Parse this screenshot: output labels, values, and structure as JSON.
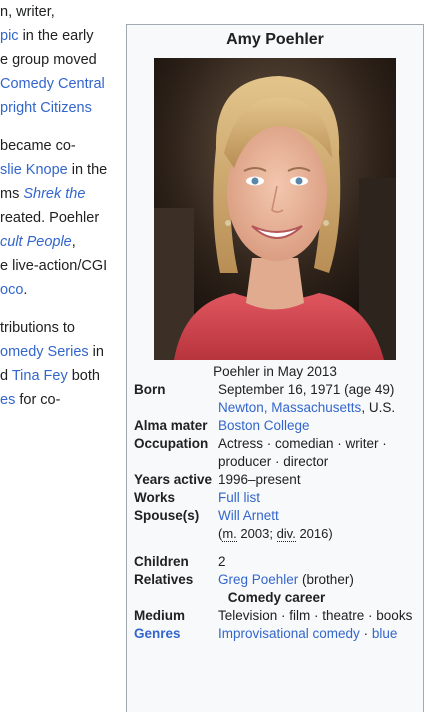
{
  "article": {
    "para1": [
      [
        {
          "t": "n, writer,",
          "c": "plain"
        }
      ],
      [
        {
          "t": "pic",
          "c": "link"
        },
        {
          "t": " in the early",
          "c": "plain"
        }
      ],
      [
        {
          "t": "e group moved",
          "c": "plain"
        }
      ],
      [
        {
          "t": "Comedy Central",
          "c": "link"
        }
      ],
      [
        {
          "t": "pright Citizens",
          "c": "link"
        }
      ]
    ],
    "para2": [
      [
        {
          "t": "became co-",
          "c": "plain"
        }
      ],
      [
        {
          "t": "slie Knope",
          "c": "link"
        },
        {
          "t": " in the",
          "c": "plain"
        }
      ],
      [
        {
          "t": "ms ",
          "c": "plain"
        },
        {
          "t": "Shrek the",
          "c": "link ital"
        }
      ],
      [
        {
          "t": "reated. Poehler",
          "c": "plain"
        }
      ],
      [
        {
          "t": "cult People",
          "c": "link ital"
        },
        {
          "t": ",",
          "c": "plain"
        }
      ],
      [
        {
          "t": "e live-action/CGI",
          "c": "plain"
        }
      ],
      [
        {
          "t": "oco",
          "c": "link"
        },
        {
          "t": ".",
          "c": "plain"
        }
      ]
    ],
    "para3": [
      [
        {
          "t": "tributions to",
          "c": "plain"
        }
      ],
      [
        {
          "t": "omedy Series",
          "c": "link"
        },
        {
          "t": " in",
          "c": "plain"
        }
      ],
      [
        {
          "t": "d ",
          "c": "plain"
        },
        {
          "t": "Tina Fey",
          "c": "link"
        },
        {
          "t": " both",
          "c": "plain"
        }
      ],
      [
        {
          "t": "es",
          "c": "link"
        },
        {
          "t": " for co-",
          "c": "plain"
        }
      ]
    ]
  },
  "infobox": {
    "title": "Amy Poehler",
    "caption": "Poehler in May 2013",
    "born_label": "Born",
    "born_date": "September 16, 1971 (age 49)",
    "born_place_link": "Newton, Massachusetts",
    "born_place_rest": ", U.S.",
    "alma_label": "Alma mater",
    "alma_value": "Boston College",
    "occupation_label": "Occupation",
    "occupation_value": "Actress · comedian · writer · producer · director",
    "years_label": "Years active",
    "years_value": "1996–present",
    "works_label": "Works",
    "works_value": "Full list",
    "spouse_label": "Spouse(s)",
    "spouse_name": "Will Arnett",
    "spouse_m": "m.",
    "spouse_m_year": " 2003; ",
    "spouse_div": "div.",
    "spouse_div_year": " 2016)",
    "spouse_open": "(",
    "children_label": "Children",
    "children_value": "2",
    "relatives_label": "Relatives",
    "relatives_link": "Greg Poehler",
    "relatives_rest": " (brother)",
    "comedy_career_header": "Comedy career",
    "medium_label": "Medium",
    "medium_value": "Television · film · theatre · books",
    "genres_label": "Genres",
    "genres_value1": "Improvisational comedy",
    "genres_sep": " · ",
    "genres_value2": "blue"
  },
  "colors": {
    "link": "#3366cc",
    "text": "#202122",
    "infobox_bg": "#f8f9fa",
    "infobox_border": "#a2a9b1"
  }
}
